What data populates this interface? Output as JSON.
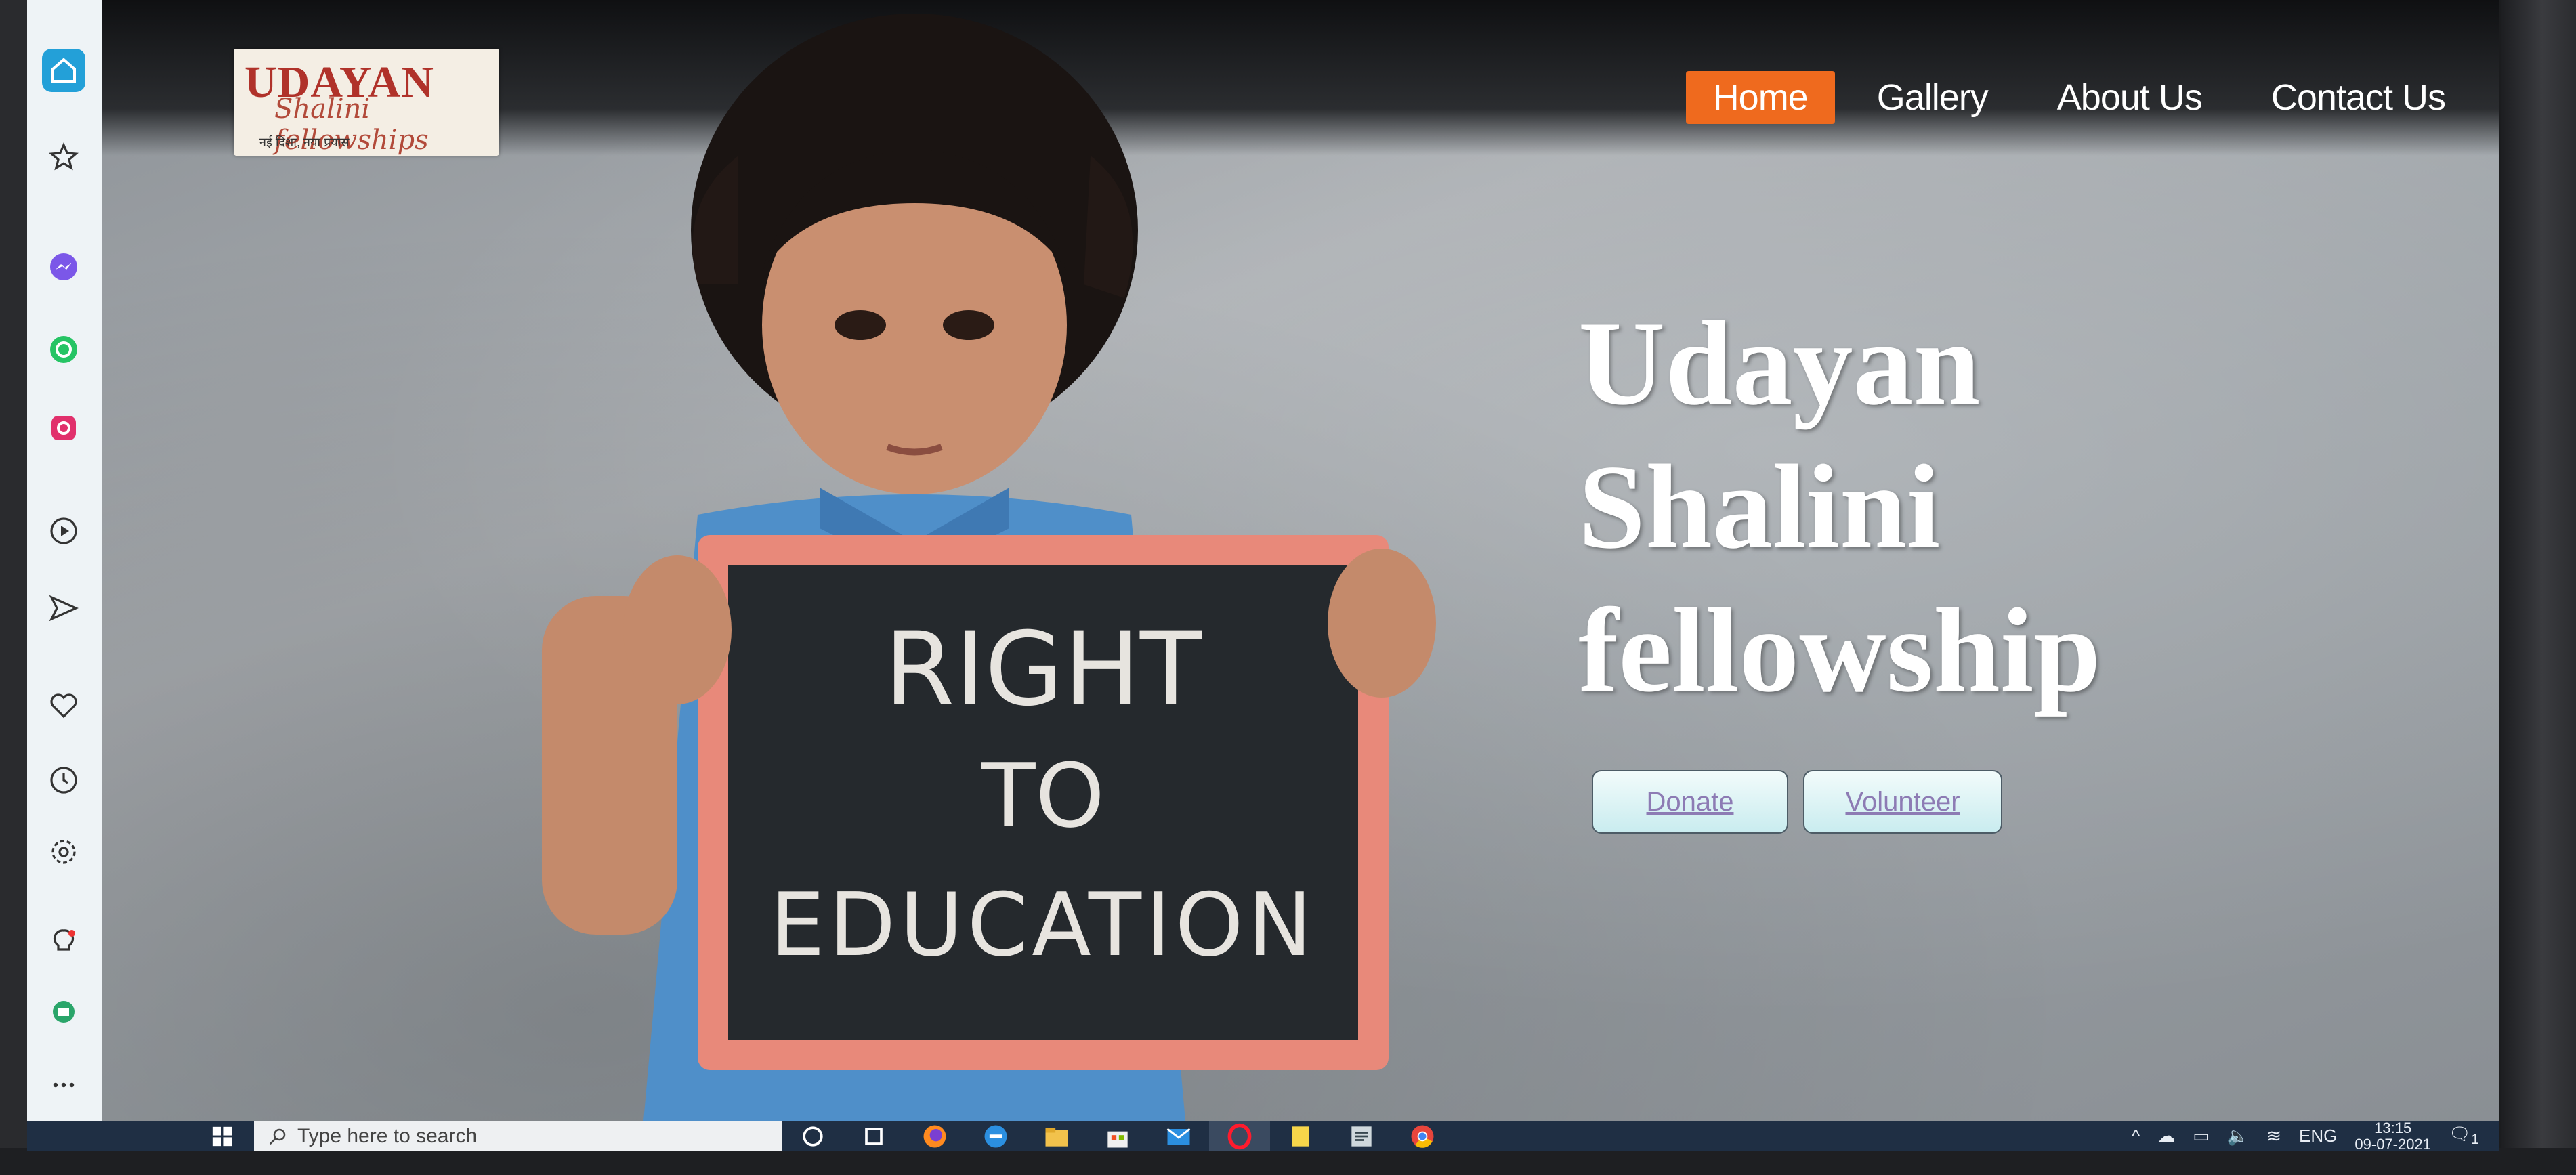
{
  "site": {
    "logo": {
      "main": "UDAYAN",
      "sub": "Shalini fellowships",
      "tagline": "नई दिशा, नया प्रयास"
    },
    "nav": [
      {
        "label": "Home",
        "active": true
      },
      {
        "label": "Gallery",
        "active": false
      },
      {
        "label": "About Us",
        "active": false
      },
      {
        "label": "Contact Us",
        "active": false
      }
    ],
    "hero": {
      "title_lines": [
        "Udayan",
        "Shalini",
        "fellowship"
      ],
      "photo_sign": [
        "RIGHT",
        "TO",
        "EDUCATION"
      ],
      "donate_label": "Donate",
      "volunteer_label": "Volunteer"
    },
    "colors": {
      "nav_active_bg": "#ef6a1e",
      "button_text": "#8d7bb4",
      "logo_red": "#b0322a"
    }
  },
  "browser_sidebar": {
    "icons": [
      "home-icon",
      "star-icon",
      "messenger-icon",
      "whatsapp-icon",
      "instagram-icon",
      "play-icon",
      "send-icon",
      "heart-icon",
      "clock-icon",
      "gear-icon",
      "bulb-icon",
      "wallet-icon",
      "more-icon"
    ]
  },
  "taskbar": {
    "search_placeholder": "Type here to search",
    "language": "ENG",
    "time": "13:15",
    "date": "09-07-2021",
    "notification_count": "1"
  }
}
